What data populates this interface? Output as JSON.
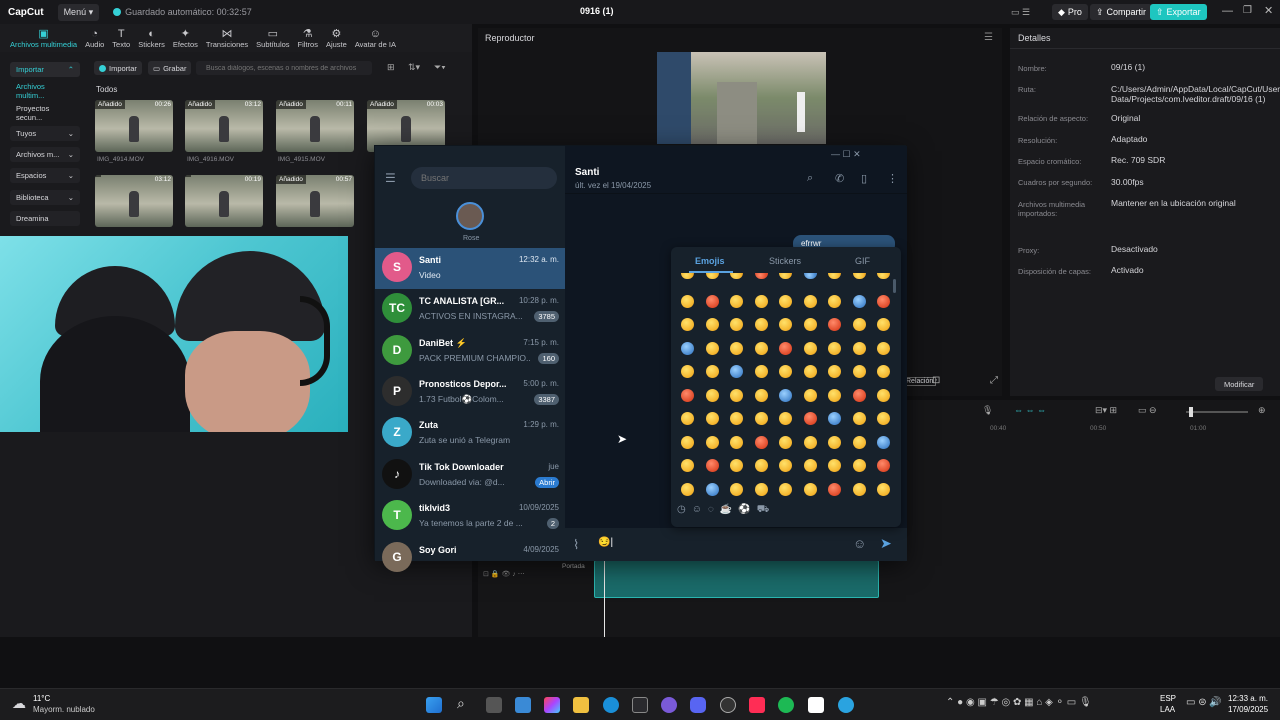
{
  "app": {
    "brand": "CapCut",
    "menu_label": "Menú",
    "autosave": "Guardado automático: 00:32:57",
    "project_title": "0916 (1)",
    "pro_label": "Pro",
    "share_label": "Compartir",
    "export_label": "Exportar"
  },
  "colors": {
    "accent": "#35d0d6",
    "telegram_selected": "#2b5278",
    "telegram_bg": "#17212b",
    "export_bg": "#1ec6c0"
  },
  "toolbar": {
    "items": [
      {
        "label": "Archivos multimedia",
        "icon": "media-icon"
      },
      {
        "label": "Audio",
        "icon": "audio-icon"
      },
      {
        "label": "Texto",
        "icon": "text-icon"
      },
      {
        "label": "Stickers",
        "icon": "sticker-icon"
      },
      {
        "label": "Efectos",
        "icon": "effects-icon"
      },
      {
        "label": "Transiciones",
        "icon": "transitions-icon"
      },
      {
        "label": "Subtítulos",
        "icon": "subtitles-icon"
      },
      {
        "label": "Filtros",
        "icon": "filters-icon"
      },
      {
        "label": "Ajuste",
        "icon": "adjust-icon"
      },
      {
        "label": "Avatar de IA",
        "icon": "avatar-icon"
      }
    ]
  },
  "media": {
    "side_items": [
      "Importar",
      "Archivos multim...",
      "Proyectos secun...",
      "Tuyos",
      "Archivos m...",
      "Espacios",
      "Biblioteca",
      "Dreamina"
    ],
    "import_btn": "Importar",
    "record_btn": "Grabar",
    "search_placeholder": "Busca diálogos, escenas o nombres de archivos",
    "section": "Todos",
    "clips": [
      {
        "tag": "Añadido",
        "duration": "00:26",
        "name": "IMG_4914.MOV"
      },
      {
        "tag": "Añadido",
        "duration": "03:12",
        "name": "IMG_4916.MOV"
      },
      {
        "tag": "Añadido",
        "duration": "00:11",
        "name": "IMG_4915.MOV"
      },
      {
        "tag": "Añadido",
        "duration": "00:03",
        "name": ""
      },
      {
        "tag": "",
        "duration": "03:12",
        "name": ""
      },
      {
        "tag": "",
        "duration": "00:19",
        "name": ""
      },
      {
        "tag": "Añadido",
        "duration": "00:57",
        "name": ""
      }
    ]
  },
  "player": {
    "title": "Reproductor",
    "ratio_label": "Relación"
  },
  "details": {
    "title": "Detalles",
    "rows": [
      {
        "label": "Nombre:",
        "value": "09/16 (1)"
      },
      {
        "label": "Ruta:",
        "value": "C:/Users/Admin/AppData/Local/CapCut/User Data/Projects/com.lveditor.draft/09/16 (1)"
      },
      {
        "label": "Relación de aspecto:",
        "value": "Original"
      },
      {
        "label": "Resolución:",
        "value": "Adaptado"
      },
      {
        "label": "Espacio cromático:",
        "value": "Rec. 709 SDR"
      },
      {
        "label": "Cuadros por segundo:",
        "value": "30.00fps"
      },
      {
        "label": "Archivos multimedia importados:",
        "value": "Mantener en la ubicación original"
      },
      {
        "label": "Proxy:",
        "value": "Desactivado"
      },
      {
        "label": "Disposición de capas:",
        "value": "Activado"
      }
    ],
    "modify_btn": "Modificar"
  },
  "timeline": {
    "ticks": [
      "00:40",
      "00:50",
      "01:00"
    ],
    "cover_label": "Portada"
  },
  "telegram": {
    "search_placeholder": "Buscar",
    "story_name": "Rose",
    "chats": [
      {
        "name": "Santi",
        "time": "12:32 a. m.",
        "preview": "Video",
        "badge": "",
        "avatar_letter": "S",
        "avatar_color": "#e25a8a"
      },
      {
        "name": "TC ANALISTA [GR...",
        "time": "10:28 p. m.",
        "preview": "ACTIVOS EN INSTAGRA...",
        "badge": "3785",
        "avatar_letter": "TC",
        "avatar_color": "#2f8f3a"
      },
      {
        "name": "DaniBet ⚡",
        "time": "7:15 p. m.",
        "preview": "PACK PREMIUM CHAMPIO...",
        "badge": "160",
        "avatar_letter": "D",
        "avatar_color": "#3e9a3e"
      },
      {
        "name": "Pronosticos Depor...",
        "time": "5:00 p. m.",
        "preview": "1.73 Futbol⚽Colom...",
        "badge": "3387",
        "avatar_letter": "P",
        "avatar_color": "#2d2d2d"
      },
      {
        "name": "Zuta",
        "time": "1:29 p. m.",
        "preview": "Zuta se unió a Telegram",
        "badge": "",
        "avatar_letter": "Z",
        "avatar_color": "#3aa9c9"
      },
      {
        "name": "Tik Tok Downloader",
        "time": "jue",
        "preview": "Downloaded via: @d...",
        "badge": "Abrir",
        "avatar_letter": "♪",
        "avatar_color": "#111111"
      },
      {
        "name": "tiklvid3",
        "time": "10/09/2025",
        "preview": "Ya tenemos la parte 2 de ...",
        "badge": "2",
        "avatar_letter": "T",
        "avatar_color": "#4cb84c"
      },
      {
        "name": "Soy Gori",
        "time": "4/09/2025",
        "preview": "",
        "badge": "",
        "avatar_letter": "G",
        "avatar_color": "#7a6a5a"
      }
    ],
    "conversation": {
      "name": "Santi",
      "status": "últ. vez el 19/04/2025",
      "message_partial": "efrrwr"
    },
    "emoji_tabs": [
      "Emojis",
      "Stickers",
      "GIF"
    ],
    "input_value": "😏|"
  },
  "taskbar": {
    "weather_temp": "11°C",
    "weather_desc": "Mayorm. nublado",
    "lang": "ESP",
    "lang2": "LAA",
    "time": "12:33 a. m.",
    "date": "17/09/2025"
  }
}
